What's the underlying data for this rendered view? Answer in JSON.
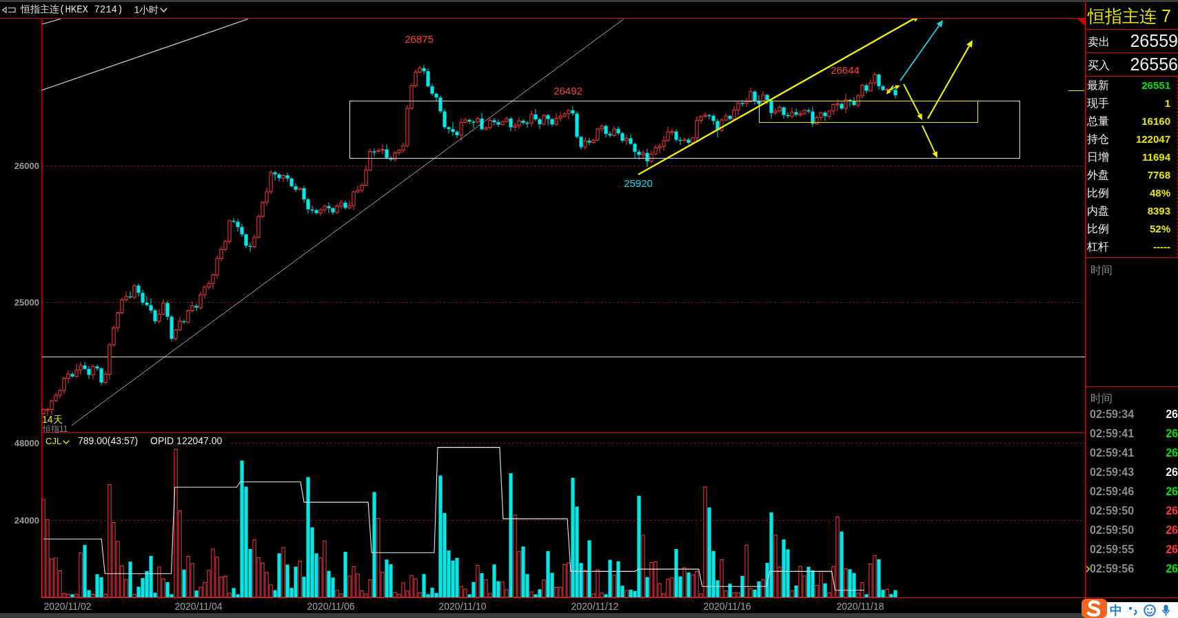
{
  "header": {
    "title": "恒指主连(HKEX 7214)",
    "period": "1小时"
  },
  "price_chart": {
    "y_labels": [
      "26000",
      "25000"
    ],
    "price_labels": [
      {
        "text": "26875",
        "kind": "high"
      },
      {
        "text": "26492",
        "kind": "high"
      },
      {
        "text": "25920",
        "kind": "low"
      },
      {
        "text": "26644",
        "kind": "high"
      }
    ],
    "span_label": "14天",
    "overlay_label": "恒指11"
  },
  "volume_chart": {
    "indicator": "CJL",
    "reading": "789.00(43:57)",
    "open_interest": "OPID 122047.00",
    "y_labels": [
      "48000",
      "24000"
    ]
  },
  "date_axis": [
    "2020/11/02",
    "2020/11/04",
    "2020/11/06",
    "2020/11/10",
    "2020/11/12",
    "2020/11/16",
    "2020/11/18"
  ],
  "quote_panel": {
    "title": "恒指主连 7",
    "ask": {
      "label": "卖出",
      "value": "26559"
    },
    "bid": {
      "label": "买入",
      "value": "26556"
    },
    "stats": [
      {
        "label": "最新",
        "value": "26551",
        "color": "#00dd00"
      },
      {
        "label": "现手",
        "value": "1",
        "color": "#e6e600"
      },
      {
        "label": "总量",
        "value": "16160",
        "color": "#e6e600"
      },
      {
        "label": "持仓",
        "value": "122047",
        "color": "#e6e600"
      },
      {
        "label": "日增",
        "value": "11694",
        "color": "#e6e600"
      },
      {
        "label": "外盘",
        "value": "7768",
        "color": "#e6e600"
      },
      {
        "label": "比例",
        "value": "48%",
        "color": "#e6e600"
      },
      {
        "label": "内盘",
        "value": "8393",
        "color": "#e6e600"
      },
      {
        "label": "比例",
        "value": "52%",
        "color": "#e6e600"
      },
      {
        "label": "杠杆",
        "value": "-----",
        "color": "#e6e600"
      }
    ]
  },
  "minute_table": {
    "header": "时间"
  },
  "tick_list": {
    "header": "时间",
    "rows": [
      {
        "time": "02:59:34",
        "price": "26",
        "color": "#f0f0f0",
        "selected": false
      },
      {
        "time": "02:59:41",
        "price": "26",
        "color": "#00dd00",
        "selected": false
      },
      {
        "time": "02:59:41",
        "price": "26",
        "color": "#00dd00",
        "selected": false
      },
      {
        "time": "02:59:43",
        "price": "26",
        "color": "#f0f0f0",
        "selected": false
      },
      {
        "time": "02:59:46",
        "price": "26",
        "color": "#00dd00",
        "selected": false
      },
      {
        "time": "02:59:50",
        "price": "26",
        "color": "#ff3333",
        "selected": false
      },
      {
        "time": "02:59:50",
        "price": "26",
        "color": "#ff3333",
        "selected": false
      },
      {
        "time": "02:59:55",
        "price": "26",
        "color": "#ff3333",
        "selected": false
      },
      {
        "time": "02:59:56",
        "price": "26",
        "color": "#00dd00",
        "selected": true
      }
    ]
  },
  "ime_toolbar": {
    "mode": "中"
  }
}
